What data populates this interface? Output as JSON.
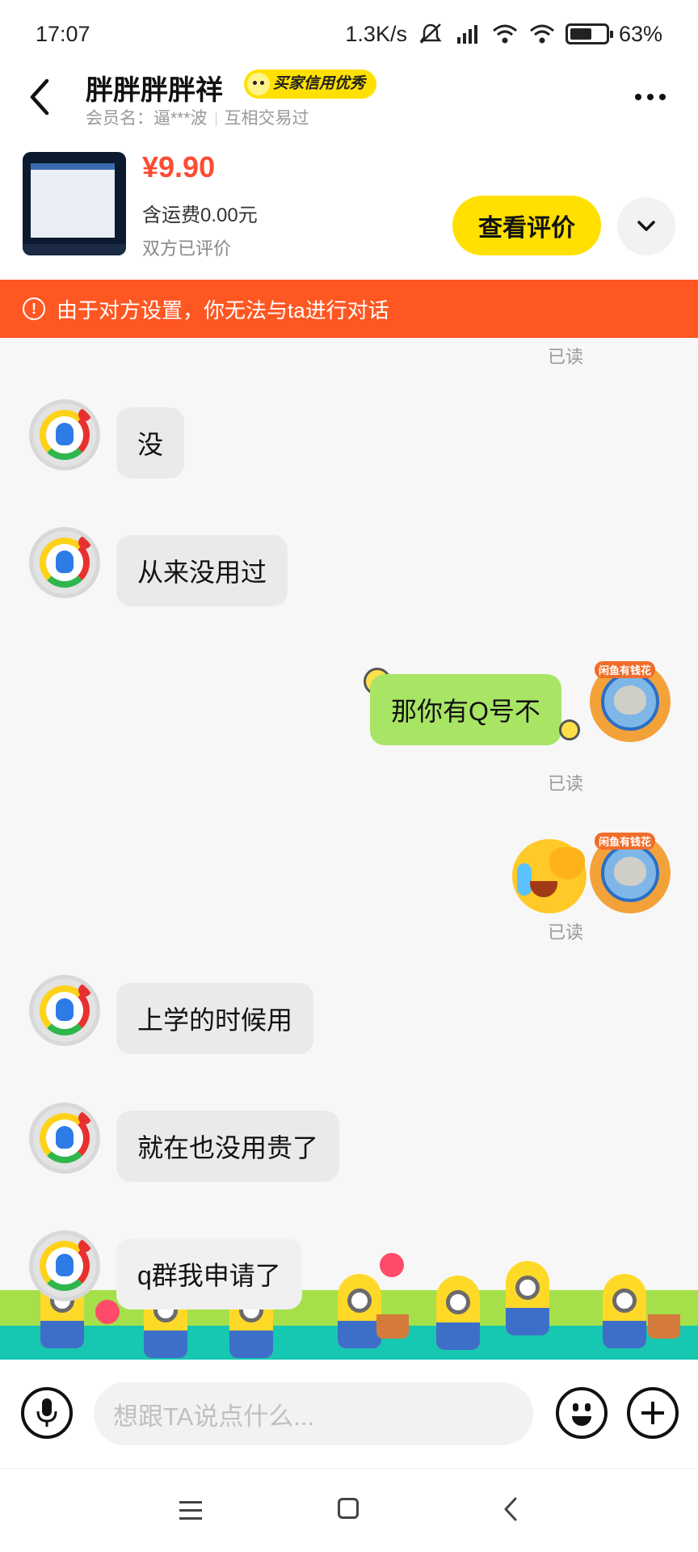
{
  "status_bar": {
    "time": "17:07",
    "net_speed": "1.3K/s",
    "battery": "63%",
    "battery_level": 0.63,
    "icons": [
      "mute-icon",
      "signal-icon",
      "wifi-icon",
      "wifi-icon",
      "battery-icon"
    ]
  },
  "header": {
    "title": "胖胖胖胖祥",
    "credit_badge": "买家信用优秀",
    "member_label": "会员名：逼***波",
    "trade_status": "互相交易过"
  },
  "product": {
    "price": "¥9.90",
    "shipping": "含运费0.00元",
    "review_status": "双方已评价",
    "review_button": "查看评价"
  },
  "banner": {
    "text": "由于对方设置，你无法与ta进行对话",
    "color": "#ff5722"
  },
  "chat": {
    "read_label": "已读",
    "messages": [
      {
        "side": "left",
        "text": "没"
      },
      {
        "side": "left",
        "text": "从来没用过"
      },
      {
        "side": "right",
        "text": "那你有Q号不"
      },
      {
        "side": "right",
        "type": "emoji",
        "emoji": "crying-laughing-emoji"
      },
      {
        "side": "left",
        "text": "上学的时候用"
      },
      {
        "side": "left",
        "text": "就在也没用贵了"
      },
      {
        "side": "left",
        "text": "q群我申请了"
      }
    ],
    "my_avatar_tag": "闲鱼有钱花"
  },
  "input": {
    "placeholder": "想跟TA说点什么..."
  },
  "colors": {
    "accent_yellow": "#ffe000",
    "price_red": "#ff4b33",
    "my_bubble": "#a9e564",
    "their_bubble": "#eaeaea"
  }
}
